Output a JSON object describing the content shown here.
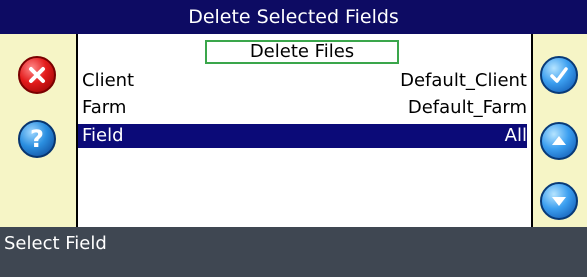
{
  "window": {
    "title": "Delete Selected Fields"
  },
  "mode": {
    "label": "Delete Files"
  },
  "rows": [
    {
      "label": "Client",
      "value": "Default_Client",
      "selected": false
    },
    {
      "label": "Farm",
      "value": "Default_Farm",
      "selected": false
    },
    {
      "label": "Field",
      "value": "All",
      "selected": true
    }
  ],
  "status": {
    "text": "Select Field"
  },
  "buttons": {
    "cancel_icon": "close-icon",
    "help_icon": "help-icon",
    "confirm_icon": "checkmark-icon",
    "up_icon": "arrow-up-icon",
    "down_icon": "arrow-down-icon",
    "help_glyph": "?"
  },
  "colors": {
    "title_bar": "#0d0b63",
    "panel": "#f6f5c6",
    "selected_row": "#0b0a78",
    "status_bar": "#3f4752",
    "mode_border": "#3aa64b"
  }
}
